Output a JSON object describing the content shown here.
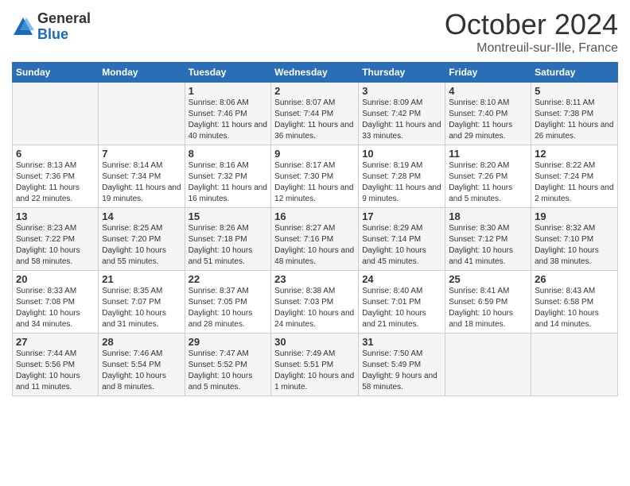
{
  "logo": {
    "general": "General",
    "blue": "Blue"
  },
  "title": "October 2024",
  "location": "Montreuil-sur-Ille, France",
  "headers": [
    "Sunday",
    "Monday",
    "Tuesday",
    "Wednesday",
    "Thursday",
    "Friday",
    "Saturday"
  ],
  "weeks": [
    [
      {
        "day": "",
        "info": ""
      },
      {
        "day": "",
        "info": ""
      },
      {
        "day": "1",
        "info": "Sunrise: 8:06 AM\nSunset: 7:46 PM\nDaylight: 11 hours and 40 minutes."
      },
      {
        "day": "2",
        "info": "Sunrise: 8:07 AM\nSunset: 7:44 PM\nDaylight: 11 hours and 36 minutes."
      },
      {
        "day": "3",
        "info": "Sunrise: 8:09 AM\nSunset: 7:42 PM\nDaylight: 11 hours and 33 minutes."
      },
      {
        "day": "4",
        "info": "Sunrise: 8:10 AM\nSunset: 7:40 PM\nDaylight: 11 hours and 29 minutes."
      },
      {
        "day": "5",
        "info": "Sunrise: 8:11 AM\nSunset: 7:38 PM\nDaylight: 11 hours and 26 minutes."
      }
    ],
    [
      {
        "day": "6",
        "info": "Sunrise: 8:13 AM\nSunset: 7:36 PM\nDaylight: 11 hours and 22 minutes."
      },
      {
        "day": "7",
        "info": "Sunrise: 8:14 AM\nSunset: 7:34 PM\nDaylight: 11 hours and 19 minutes."
      },
      {
        "day": "8",
        "info": "Sunrise: 8:16 AM\nSunset: 7:32 PM\nDaylight: 11 hours and 16 minutes."
      },
      {
        "day": "9",
        "info": "Sunrise: 8:17 AM\nSunset: 7:30 PM\nDaylight: 11 hours and 12 minutes."
      },
      {
        "day": "10",
        "info": "Sunrise: 8:19 AM\nSunset: 7:28 PM\nDaylight: 11 hours and 9 minutes."
      },
      {
        "day": "11",
        "info": "Sunrise: 8:20 AM\nSunset: 7:26 PM\nDaylight: 11 hours and 5 minutes."
      },
      {
        "day": "12",
        "info": "Sunrise: 8:22 AM\nSunset: 7:24 PM\nDaylight: 11 hours and 2 minutes."
      }
    ],
    [
      {
        "day": "13",
        "info": "Sunrise: 8:23 AM\nSunset: 7:22 PM\nDaylight: 10 hours and 58 minutes."
      },
      {
        "day": "14",
        "info": "Sunrise: 8:25 AM\nSunset: 7:20 PM\nDaylight: 10 hours and 55 minutes."
      },
      {
        "day": "15",
        "info": "Sunrise: 8:26 AM\nSunset: 7:18 PM\nDaylight: 10 hours and 51 minutes."
      },
      {
        "day": "16",
        "info": "Sunrise: 8:27 AM\nSunset: 7:16 PM\nDaylight: 10 hours and 48 minutes."
      },
      {
        "day": "17",
        "info": "Sunrise: 8:29 AM\nSunset: 7:14 PM\nDaylight: 10 hours and 45 minutes."
      },
      {
        "day": "18",
        "info": "Sunrise: 8:30 AM\nSunset: 7:12 PM\nDaylight: 10 hours and 41 minutes."
      },
      {
        "day": "19",
        "info": "Sunrise: 8:32 AM\nSunset: 7:10 PM\nDaylight: 10 hours and 38 minutes."
      }
    ],
    [
      {
        "day": "20",
        "info": "Sunrise: 8:33 AM\nSunset: 7:08 PM\nDaylight: 10 hours and 34 minutes."
      },
      {
        "day": "21",
        "info": "Sunrise: 8:35 AM\nSunset: 7:07 PM\nDaylight: 10 hours and 31 minutes."
      },
      {
        "day": "22",
        "info": "Sunrise: 8:37 AM\nSunset: 7:05 PM\nDaylight: 10 hours and 28 minutes."
      },
      {
        "day": "23",
        "info": "Sunrise: 8:38 AM\nSunset: 7:03 PM\nDaylight: 10 hours and 24 minutes."
      },
      {
        "day": "24",
        "info": "Sunrise: 8:40 AM\nSunset: 7:01 PM\nDaylight: 10 hours and 21 minutes."
      },
      {
        "day": "25",
        "info": "Sunrise: 8:41 AM\nSunset: 6:59 PM\nDaylight: 10 hours and 18 minutes."
      },
      {
        "day": "26",
        "info": "Sunrise: 8:43 AM\nSunset: 6:58 PM\nDaylight: 10 hours and 14 minutes."
      }
    ],
    [
      {
        "day": "27",
        "info": "Sunrise: 7:44 AM\nSunset: 5:56 PM\nDaylight: 10 hours and 11 minutes."
      },
      {
        "day": "28",
        "info": "Sunrise: 7:46 AM\nSunset: 5:54 PM\nDaylight: 10 hours and 8 minutes."
      },
      {
        "day": "29",
        "info": "Sunrise: 7:47 AM\nSunset: 5:52 PM\nDaylight: 10 hours and 5 minutes."
      },
      {
        "day": "30",
        "info": "Sunrise: 7:49 AM\nSunset: 5:51 PM\nDaylight: 10 hours and 1 minute."
      },
      {
        "day": "31",
        "info": "Sunrise: 7:50 AM\nSunset: 5:49 PM\nDaylight: 9 hours and 58 minutes."
      },
      {
        "day": "",
        "info": ""
      },
      {
        "day": "",
        "info": ""
      }
    ]
  ]
}
